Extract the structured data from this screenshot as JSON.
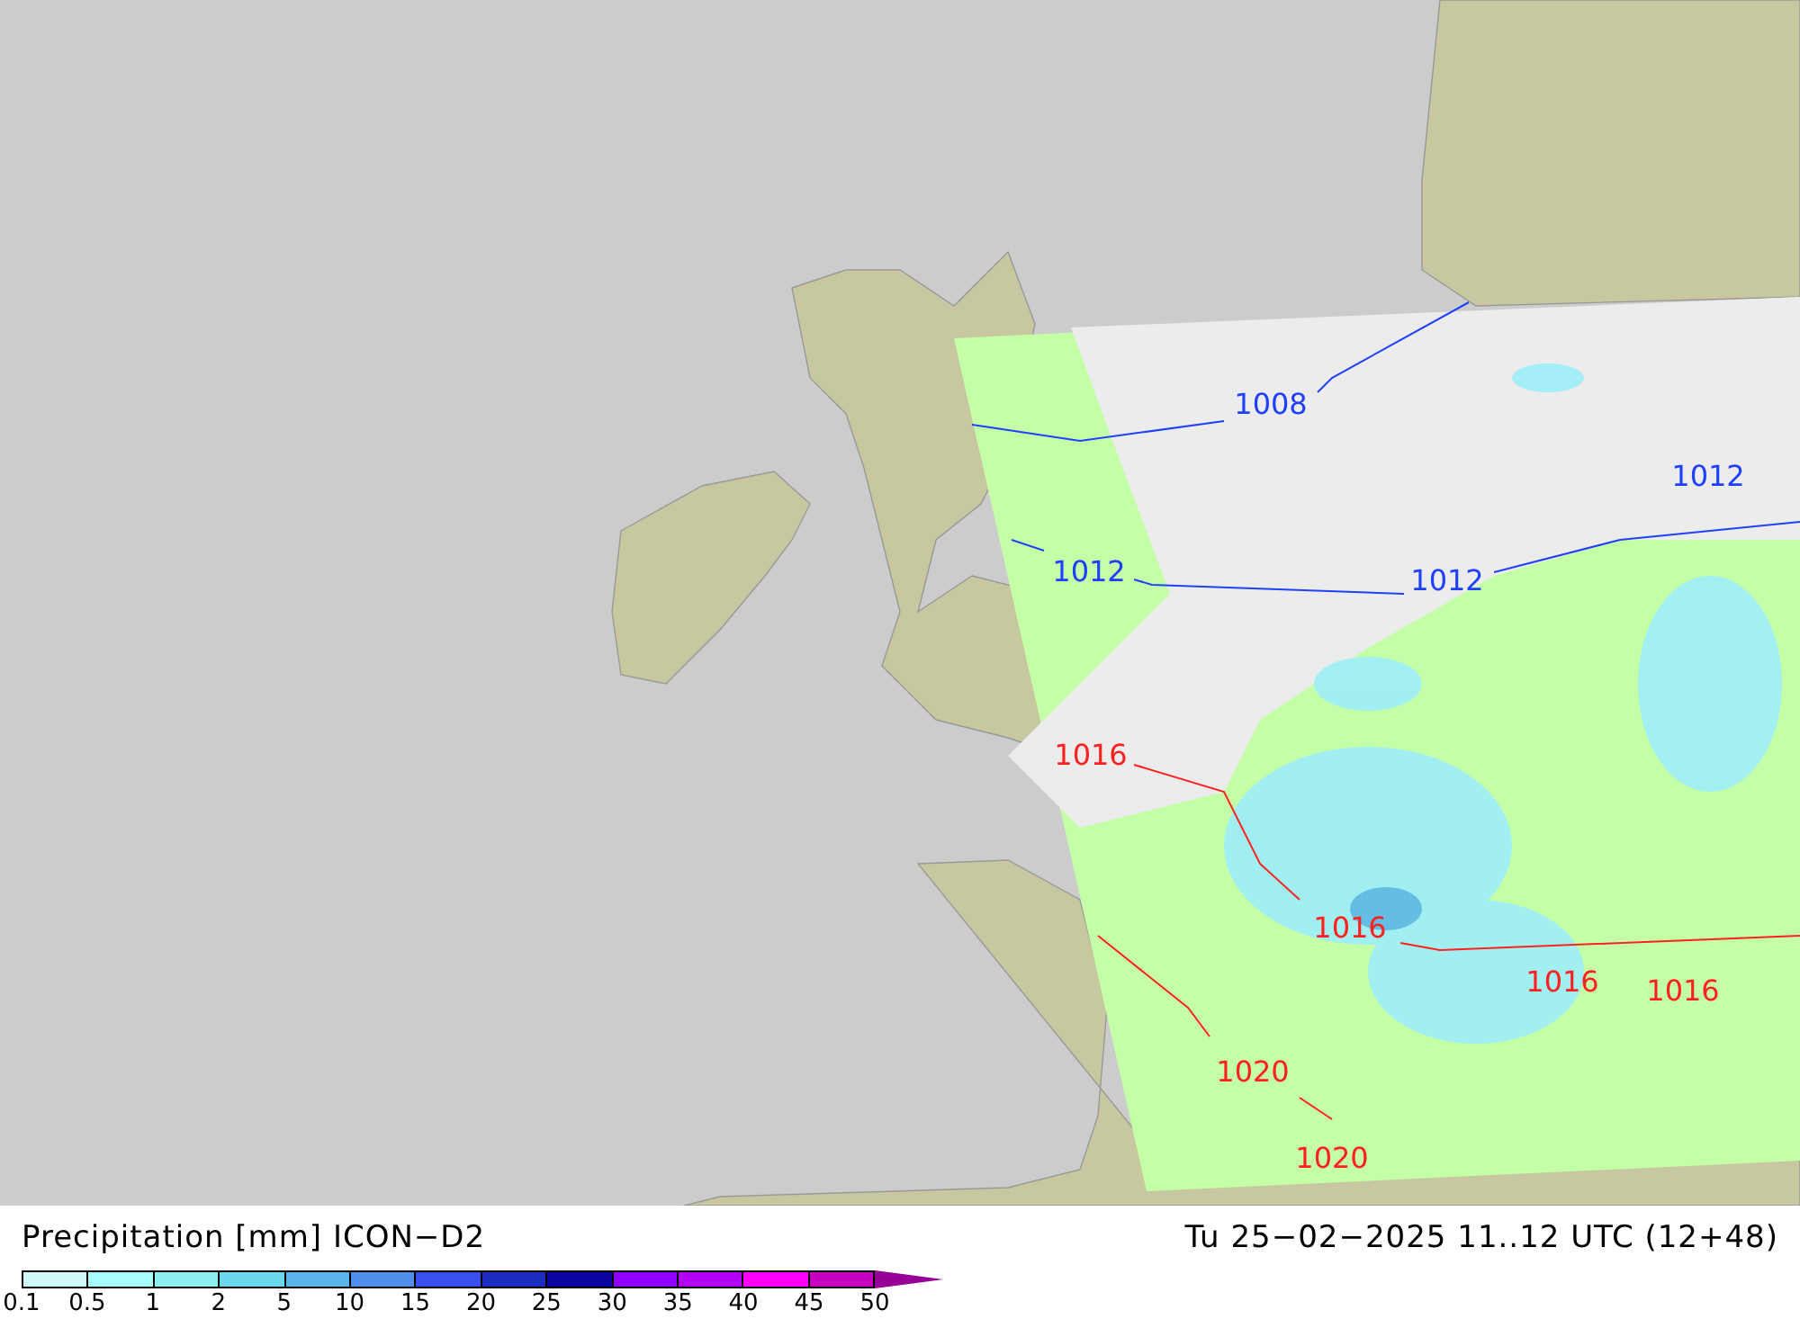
{
  "map": {
    "isobar_labels": [
      {
        "text": "1008",
        "color": "#2040ff"
      },
      {
        "text": "1012",
        "color": "#2040ff"
      },
      {
        "text": "1012",
        "color": "#2040ff"
      },
      {
        "text": "1012",
        "color": "#2040ff"
      },
      {
        "text": "1016",
        "color": "#ff2020"
      },
      {
        "text": "1016",
        "color": "#ff2020"
      },
      {
        "text": "1016",
        "color": "#ff2020"
      },
      {
        "text": "1016",
        "color": "#ff2020"
      },
      {
        "text": "1020",
        "color": "#ff2020"
      },
      {
        "text": "1020",
        "color": "#ff2020"
      }
    ]
  },
  "footer": {
    "title": "Precipitation [mm] ICON−D2",
    "valid_time": "Tu 25−02−2025 11..12 UTC (12+48)",
    "legend": [
      {
        "label": "0.1",
        "color": "#d0fafa"
      },
      {
        "label": "0.5",
        "color": "#a8fcfc"
      },
      {
        "label": "1",
        "color": "#8ceeee"
      },
      {
        "label": "2",
        "color": "#6ad8ee"
      },
      {
        "label": "5",
        "color": "#5ab6ea"
      },
      {
        "label": "10",
        "color": "#4e90ea"
      },
      {
        "label": "15",
        "color": "#3850f0"
      },
      {
        "label": "20",
        "color": "#1c2cc0"
      },
      {
        "label": "25",
        "color": "#0a04a0"
      },
      {
        "label": "30",
        "color": "#9000ff"
      },
      {
        "label": "35",
        "color": "#b400f4"
      },
      {
        "label": "40",
        "color": "#ff00ff"
      },
      {
        "label": "45",
        "color": "#c800c0"
      },
      {
        "label": "50",
        "color": "#960096"
      }
    ]
  }
}
